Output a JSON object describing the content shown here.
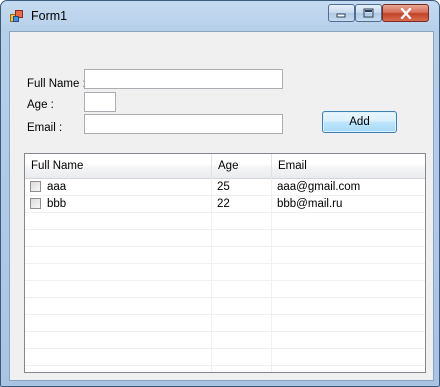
{
  "window": {
    "title": "Form1"
  },
  "form": {
    "fullname_label": "Full Name :",
    "age_label": "Age :",
    "email_label": "Email :",
    "fullname_value": "",
    "age_value": "",
    "email_value": "",
    "add_label": "Add"
  },
  "list": {
    "columns": [
      "Full Name",
      "Age",
      "Email"
    ],
    "rows": [
      {
        "checked": false,
        "name": "aaa",
        "age": "25",
        "email": "aaa@gmail.com"
      },
      {
        "checked": false,
        "name": "bbb",
        "age": "22",
        "email": "bbb@mail.ru"
      }
    ]
  },
  "colors": {
    "frame": "#b6cfe9",
    "client_bg": "#f0f0f0",
    "close_button": "#c2442a",
    "button_blue": "#bee6fd"
  }
}
